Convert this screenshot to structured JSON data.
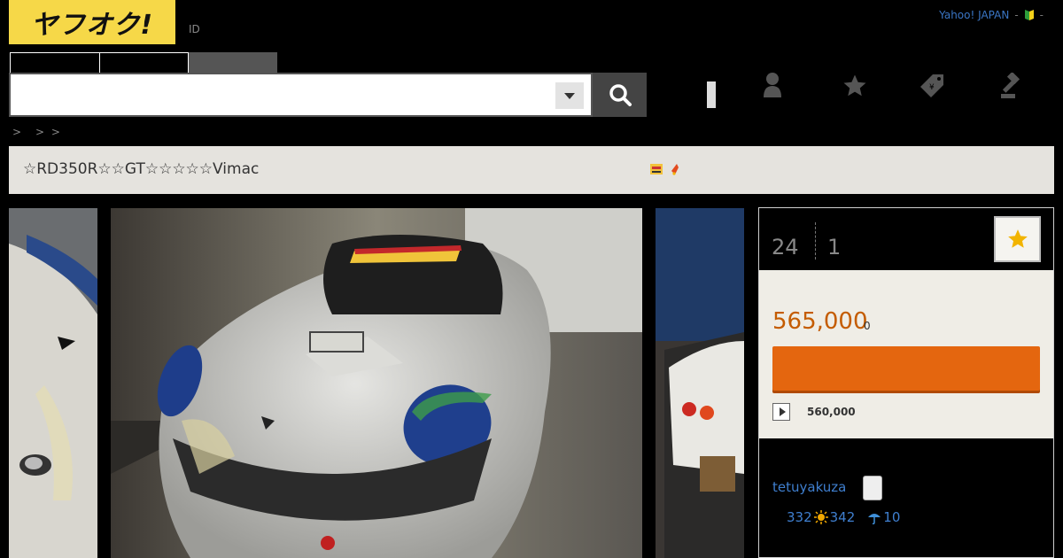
{
  "header": {
    "logo_text": "ヤフオク!",
    "id_label": "ID",
    "top_links": [
      "Yahoo! JAPAN",
      "-",
      "-"
    ],
    "leaf_icon": "beginner-leaf-icon"
  },
  "search": {
    "tabs": [
      "",
      "",
      ""
    ],
    "placeholder": "",
    "value": "",
    "dropdown_icon": "chevron-down-icon",
    "button_icon": "search-icon"
  },
  "nav_icons": [
    "notification-icon",
    "user-icon",
    "star-icon",
    "tag-icon",
    "auction-gavel-icon"
  ],
  "breadcrumb": ">　>  >",
  "listing": {
    "title": "☆RD350R☆☆GT☆☆☆☆☆Vimac",
    "title_icons": [
      "new-badge-icon",
      "hot-icon"
    ]
  },
  "side": {
    "bids": "24",
    "time_left": "1",
    "watch_icon": "star-icon",
    "price": "565,000",
    "price_suffix": "0",
    "bid_button_label": "",
    "buy_now_price": "560,000",
    "seller_name": "tetuyakuza",
    "rating_total": "332",
    "rating_good": "342",
    "rating_bad": "10"
  },
  "colors": {
    "logo_bg": "#f6d848",
    "price": "#c45c00",
    "bid_button": "#e4660f",
    "link": "#3f7fcf"
  }
}
